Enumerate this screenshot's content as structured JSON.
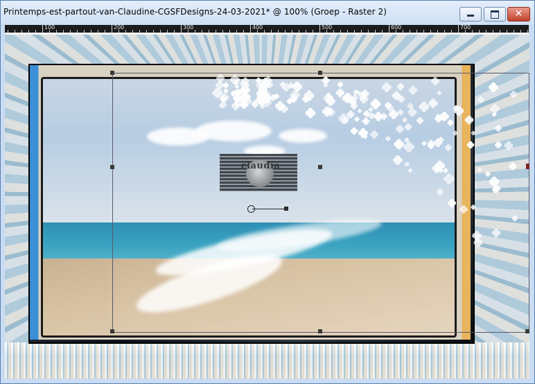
{
  "window": {
    "title": "Printemps-est-partout-van-Claudine-CGSFDesigns-24-03-2021* @ 100% (Groep - Raster 2)",
    "buttons": {
      "minimize": "minimize",
      "maximize": "maximize",
      "close": "close",
      "close_glyph": "✕"
    }
  },
  "ruler": {
    "labels": [
      "100",
      "200",
      "300",
      "400",
      "500",
      "600",
      "700"
    ]
  },
  "canvas": {
    "watermark_text": "claudia",
    "layer": "Groep - Raster 2",
    "zoom": "100%"
  },
  "colors": {
    "titlebar": "#cfe0f5",
    "close_button": "#c2432f",
    "ruler_bg": "#1b1b1b",
    "frame_accent_blue": "#3a8fd6",
    "frame_accent_gold": "#e8b45c"
  }
}
